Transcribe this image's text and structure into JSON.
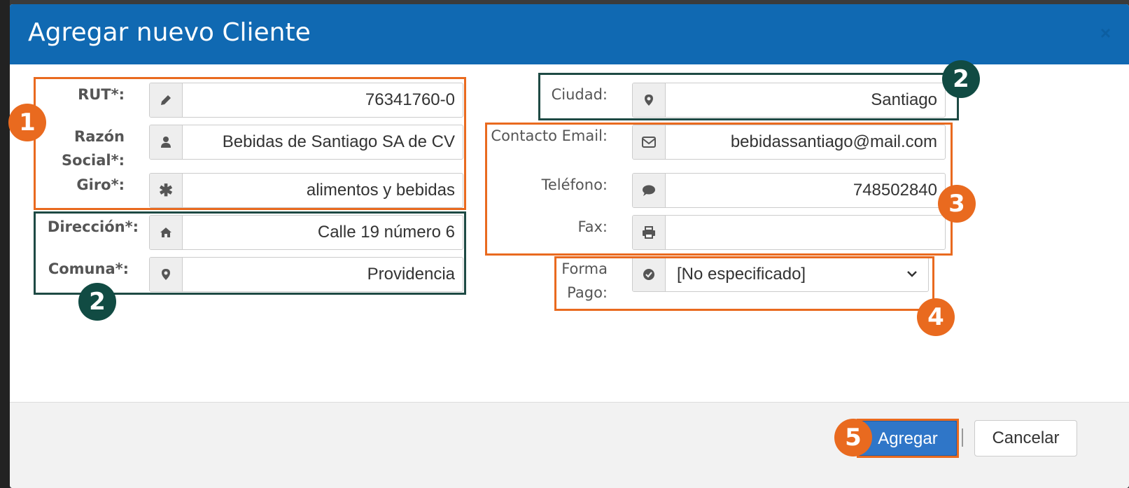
{
  "modal": {
    "title": "Agregar nuevo Cliente",
    "close": "×"
  },
  "fields": {
    "rut": {
      "label": "RUT*:",
      "value": "76341760-0",
      "icon": "pencil-icon"
    },
    "razon": {
      "label1": "Razón",
      "label2": "Social*:",
      "value": "Bebidas de Santiago SA de CV",
      "icon": "user-icon"
    },
    "giro": {
      "label": "Giro*:",
      "value": "alimentos y bebidas",
      "icon": "asterisk-icon"
    },
    "direccion": {
      "label": "Dirección*:",
      "value": "Calle 19 número 6",
      "icon": "home-icon"
    },
    "comuna": {
      "label": "Comuna*:",
      "value": "Providencia",
      "icon": "map-marker-icon"
    },
    "ciudad": {
      "label": "Ciudad:",
      "value": "Santiago",
      "icon": "map-marker-icon"
    },
    "email": {
      "label": "Contacto Email:",
      "value": "bebidassantiago@mail.com",
      "icon": "envelope-icon"
    },
    "telefono": {
      "label": "Teléfono:",
      "value": "748502840",
      "icon": "chat-bubble-icon"
    },
    "fax": {
      "label": "Fax:",
      "value": "",
      "icon": "printer-icon"
    },
    "forma_pago": {
      "label1": "Forma",
      "label2": "Pago:",
      "value": "[No especificado]",
      "icon": "check-circle-icon"
    }
  },
  "badges": {
    "b1": "1",
    "b2a": "2",
    "b2b": "2",
    "b3": "3",
    "b4": "4",
    "b5": "5"
  },
  "buttons": {
    "agregar": "Agregar",
    "cancelar": "Cancelar"
  },
  "colors": {
    "header": "#1069b2",
    "highlight_orange": "#e96a1f",
    "highlight_green": "#1e4a44",
    "primary_button": "#2f76c8"
  }
}
